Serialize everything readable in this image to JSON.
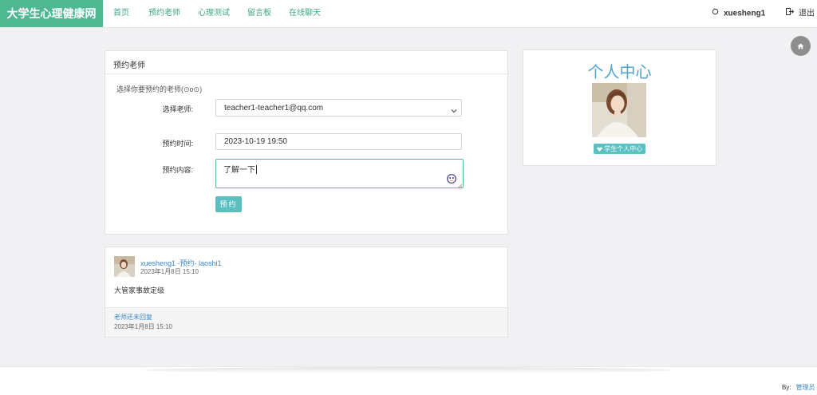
{
  "brand": "大学生心理健康网",
  "nav": [
    {
      "label": "首页"
    },
    {
      "label": "预约老师"
    },
    {
      "label": "心理测试"
    },
    {
      "label": "留言板"
    },
    {
      "label": "在线聊天"
    }
  ],
  "user": {
    "name": "xuesheng1",
    "logout_label": "退出"
  },
  "icons": {
    "home": "home-icon",
    "user": "user-icon",
    "logout": "logout-icon",
    "heart": "heart-icon",
    "emoji": "emoji-icon",
    "chevron": "chevron-down-icon"
  },
  "booking": {
    "title": "预约老师",
    "hint": "选择你要预约的老师(⊙o⊙)",
    "teacher_label": "选择老师:",
    "teacher_value": "teacher1-teacher1@qq.com",
    "time_label": "预约时间:",
    "time_value": "2023-10-19 19:50",
    "content_label": "预约内容:",
    "content_value": "了解一下",
    "submit_label": "预约"
  },
  "message": {
    "title": "xuesheng1 -预约- laoshi1",
    "time": "2023年1月8日 15:10",
    "body": "大管家事故定级",
    "reply_status": "老师还未回复",
    "reply_time": "2023年1月8日 15:10"
  },
  "profile": {
    "title": "个人中心",
    "badge_label": "学生个人中心"
  },
  "footer": {
    "by_label": "By:",
    "admin_label": "管理员"
  },
  "colors": {
    "brand": "#4fb893",
    "nav_link": "#3fa68a",
    "accent": "#5bc0c2",
    "link": "#3a87c2"
  }
}
